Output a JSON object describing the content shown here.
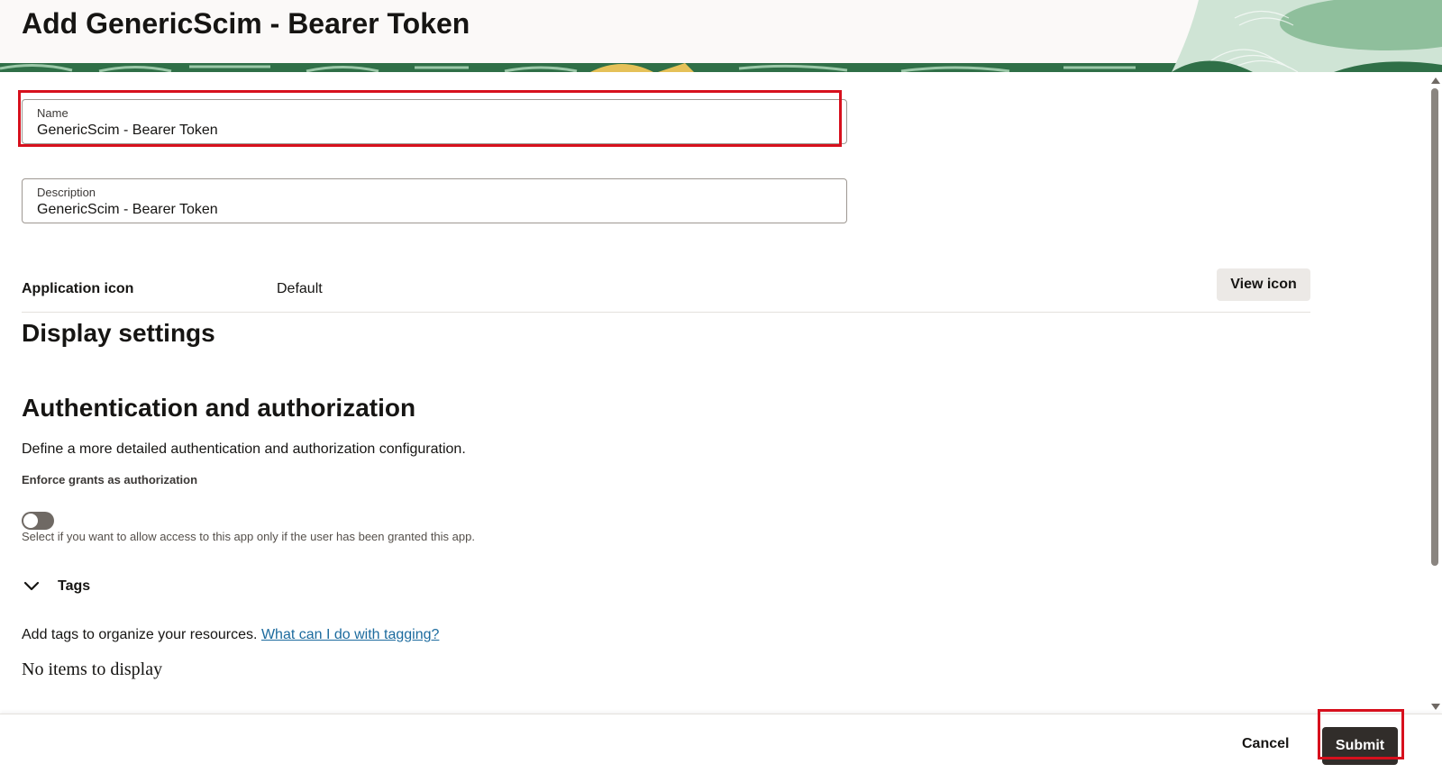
{
  "header": {
    "title": "Add GenericScim - Bearer Token"
  },
  "form": {
    "name": {
      "label": "Name",
      "value": "GenericScim - Bearer Token"
    },
    "description": {
      "label": "Description",
      "value": "GenericScim - Bearer Token"
    },
    "application_icon": {
      "label": "Application icon",
      "value": "Default",
      "button_label": "View icon"
    }
  },
  "display_settings": {
    "heading": "Display settings"
  },
  "auth": {
    "heading": "Authentication and authorization",
    "description": "Define a more detailed authentication and authorization configuration.",
    "enforce_grants": {
      "label": "Enforce grants as authorization",
      "enabled": false,
      "help": "Select if you want to allow access to this app only if the user has been granted this app."
    }
  },
  "tags": {
    "label": "Tags",
    "expanded": true,
    "chevron_icon": "chevron-down-icon",
    "intro": "Add tags to organize your resources.",
    "link": "What can I do with tagging?",
    "empty_text": "No items to display"
  },
  "footer": {
    "cancel_label": "Cancel",
    "submit_label": "Submit"
  },
  "colors": {
    "highlight": "#d7101d",
    "primary_button": "#312d2a",
    "link": "#1c6b9e",
    "banner_green": "#2f6f47"
  }
}
